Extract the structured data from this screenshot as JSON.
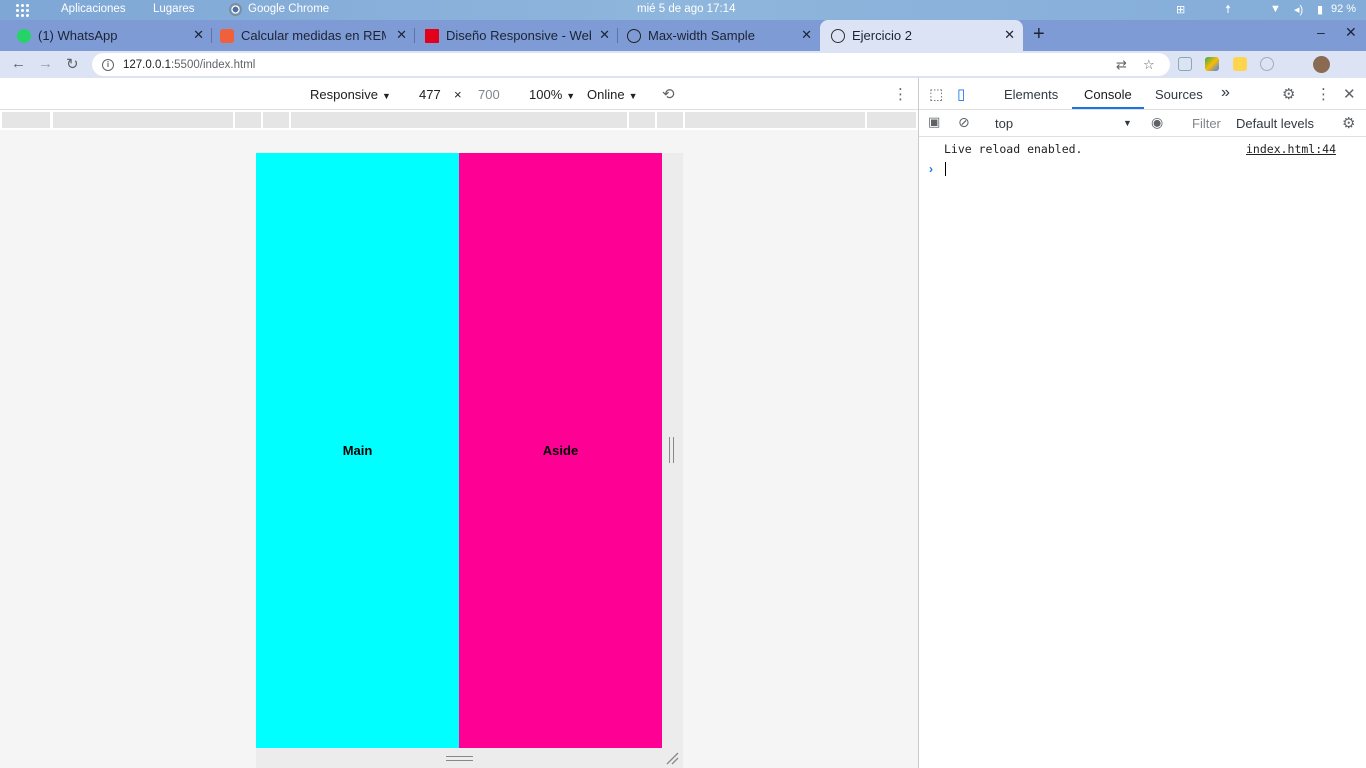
{
  "topbar": {
    "activities": "Aplicaciones",
    "places": "Lugares",
    "app": "Google Chrome",
    "clock": "mié 5 de ago  17:14",
    "battery": "92 %"
  },
  "tabs": [
    {
      "label": "(1) WhatsApp",
      "favicon_color": "#25d366"
    },
    {
      "label": "Calcular medidas en REM",
      "favicon_color": "#f0603a"
    },
    {
      "label": "Diseño Responsive - Web",
      "favicon_color": "#e3001b"
    },
    {
      "label": "Max-width Sample",
      "favicon_color": "#222222"
    },
    {
      "label": "Ejercicio 2",
      "favicon_color": "#333333",
      "active": true
    }
  ],
  "window_controls": {
    "minimize": "–",
    "close": "✕"
  },
  "new_tab": "+",
  "address": {
    "host": "127.0.0.1",
    "path": ":5500/index.html"
  },
  "device_toolbar": {
    "device": "Responsive",
    "width": "477",
    "times": "×",
    "height": "700",
    "zoom": "100%",
    "throttle": "Online"
  },
  "page": {
    "main_label": "Main",
    "aside_label": "Aside",
    "main_color": "#00ffff",
    "aside_color": "#ff0095"
  },
  "devtools": {
    "tabs": [
      "Elements",
      "Console",
      "Sources"
    ],
    "active_tab": "Console",
    "more_tabs": "»",
    "context": "top",
    "filter_placeholder": "Filter",
    "levels": "Default levels",
    "console_message": "Live reload enabled.",
    "console_source": "index.html:44",
    "prompt": "›"
  }
}
